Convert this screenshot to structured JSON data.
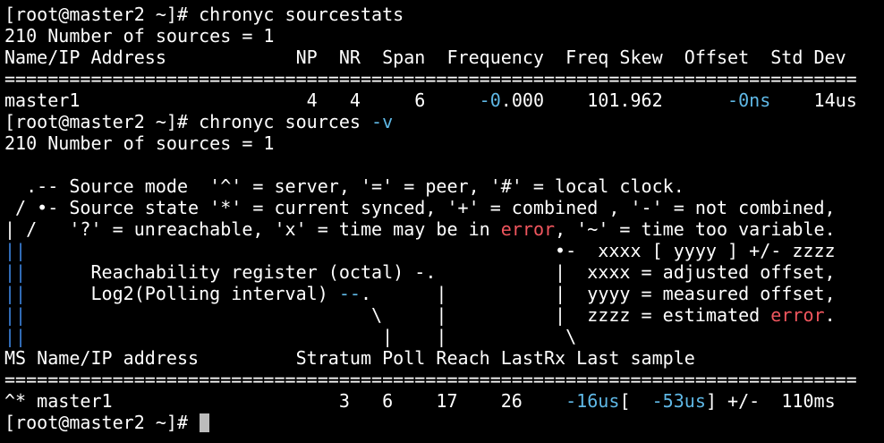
{
  "colors": {
    "background": "#000000",
    "foreground": "#ffffff",
    "value_blue": "#5fb8e6",
    "error_red": "#f0565e",
    "guide_blue": "#3a7fd6",
    "cursor": "#bcbcbc"
  },
  "terminal": {
    "lines": [
      [
        {
          "t": "[root@master2 ~]# chronyc sourcestats"
        }
      ],
      [
        {
          "t": "210 Number of sources = 1"
        }
      ],
      [
        {
          "t": "Name/IP Address            NP  NR  Span  Frequency  Freq Skew  Offset  Std Dev"
        }
      ],
      [
        {
          "t": "==============================================================================="
        }
      ],
      [
        {
          "t": "master1                     4   4     6     "
        },
        {
          "t": "-0",
          "c": "blue"
        },
        {
          "t": ".000    101.962      "
        },
        {
          "t": "-0ns",
          "c": "blue"
        },
        {
          "t": "    14us"
        }
      ],
      [
        {
          "t": "[root@master2 ~]# chronyc sources "
        },
        {
          "t": "-v",
          "c": "blue"
        }
      ],
      [
        {
          "t": "210 Number of sources = 1"
        }
      ],
      [
        {
          "t": ""
        }
      ],
      [
        {
          "t": "  .-- Source mode  '^' = server, '=' = peer, '#' = local clock."
        }
      ],
      [
        {
          "t": " / •- Source state '*' = current synced, '+' = combined , '-' = not combined,"
        }
      ],
      [
        {
          "t": "| /   '?' = unreachable, 'x' = time may be in "
        },
        {
          "t": "error",
          "c": "red"
        },
        {
          "t": ", '~' = time too variable."
        }
      ],
      [
        {
          "t": "||",
          "c": "guide"
        },
        {
          "t": "                                                 •-  xxxx [ yyyy ] +/- zzzz"
        }
      ],
      [
        {
          "t": "||",
          "c": "guide"
        },
        {
          "t": "      Reachability register (octal) -.           |  xxxx = adjusted offset,"
        }
      ],
      [
        {
          "t": "||",
          "c": "guide"
        },
        {
          "t": "      Log2(Polling interval) "
        },
        {
          "t": "--",
          "c": "blue"
        },
        {
          "t": ".      |          |  yyyy = measured offset,"
        }
      ],
      [
        {
          "t": "||",
          "c": "guide"
        },
        {
          "t": "                                \\     |          |  zzzz = estimated "
        },
        {
          "t": "error",
          "c": "red"
        },
        {
          "t": "."
        }
      ],
      [
        {
          "t": "||",
          "c": "guide"
        },
        {
          "t": "                                 |    |           \\"
        }
      ],
      [
        {
          "t": "MS Name/IP address         Stratum Poll Reach LastRx Last sample"
        }
      ],
      [
        {
          "t": "==============================================================================="
        }
      ],
      [
        {
          "t": "^* master1                     3   6    17    26    "
        },
        {
          "t": "-16us",
          "c": "blue"
        },
        {
          "t": "[  "
        },
        {
          "t": "-53us",
          "c": "blue"
        },
        {
          "t": "] +/-  110ms"
        }
      ],
      [
        {
          "t": "[root@master2 ~]# "
        },
        {
          "cursor": true
        }
      ]
    ]
  }
}
